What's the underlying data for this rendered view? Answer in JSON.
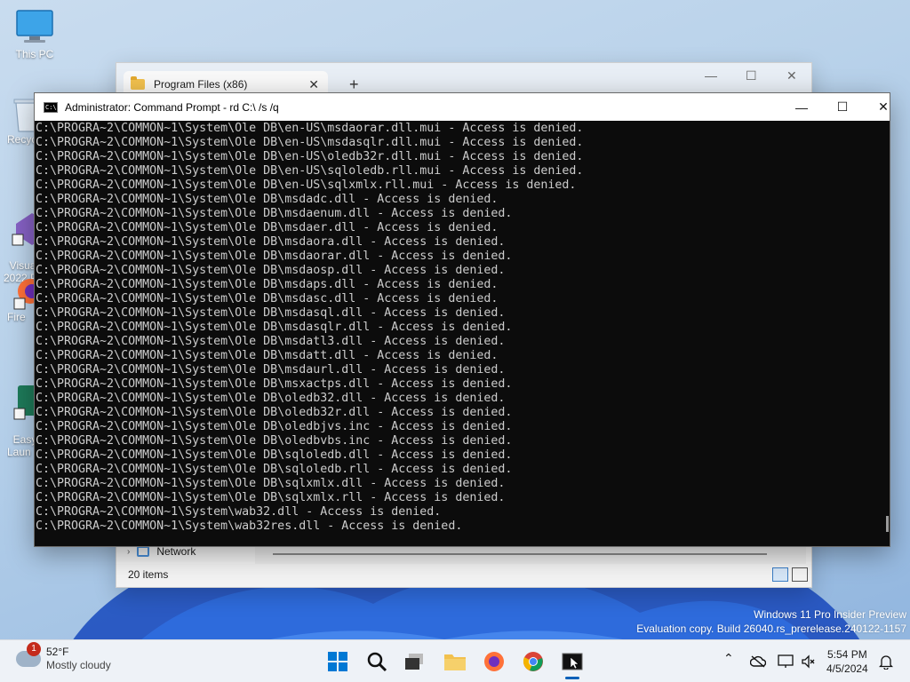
{
  "desktop": {
    "icons": [
      {
        "label": "This PC"
      },
      {
        "label": "Recyc"
      },
      {
        "label": "Visual\n2022 P"
      },
      {
        "label": "Fire"
      },
      {
        "label": "Easy\nLaun"
      }
    ]
  },
  "explorer": {
    "tab_title": "Program Files (x86)",
    "tab_close": "✕",
    "new_tab": "+",
    "nav_item": "Network",
    "status_items": "20 items"
  },
  "console": {
    "title": "Administrator: Command Prompt - rd  C:\\ /s /q",
    "minimize": "—",
    "maximize": "☐",
    "close": "✕",
    "lines": [
      "C:\\PROGRA~2\\COMMON~1\\System\\Ole DB\\en-US\\msdaorar.dll.mui - Access is denied.",
      "C:\\PROGRA~2\\COMMON~1\\System\\Ole DB\\en-US\\msdasqlr.dll.mui - Access is denied.",
      "C:\\PROGRA~2\\COMMON~1\\System\\Ole DB\\en-US\\oledb32r.dll.mui - Access is denied.",
      "C:\\PROGRA~2\\COMMON~1\\System\\Ole DB\\en-US\\sqloledb.rll.mui - Access is denied.",
      "C:\\PROGRA~2\\COMMON~1\\System\\Ole DB\\en-US\\sqlxmlx.rll.mui - Access is denied.",
      "C:\\PROGRA~2\\COMMON~1\\System\\Ole DB\\msdadc.dll - Access is denied.",
      "C:\\PROGRA~2\\COMMON~1\\System\\Ole DB\\msdaenum.dll - Access is denied.",
      "C:\\PROGRA~2\\COMMON~1\\System\\Ole DB\\msdaer.dll - Access is denied.",
      "C:\\PROGRA~2\\COMMON~1\\System\\Ole DB\\msdaora.dll - Access is denied.",
      "C:\\PROGRA~2\\COMMON~1\\System\\Ole DB\\msdaorar.dll - Access is denied.",
      "C:\\PROGRA~2\\COMMON~1\\System\\Ole DB\\msdaosp.dll - Access is denied.",
      "C:\\PROGRA~2\\COMMON~1\\System\\Ole DB\\msdaps.dll - Access is denied.",
      "C:\\PROGRA~2\\COMMON~1\\System\\Ole DB\\msdasc.dll - Access is denied.",
      "C:\\PROGRA~2\\COMMON~1\\System\\Ole DB\\msdasql.dll - Access is denied.",
      "C:\\PROGRA~2\\COMMON~1\\System\\Ole DB\\msdasqlr.dll - Access is denied.",
      "C:\\PROGRA~2\\COMMON~1\\System\\Ole DB\\msdatl3.dll - Access is denied.",
      "C:\\PROGRA~2\\COMMON~1\\System\\Ole DB\\msdatt.dll - Access is denied.",
      "C:\\PROGRA~2\\COMMON~1\\System\\Ole DB\\msdaurl.dll - Access is denied.",
      "C:\\PROGRA~2\\COMMON~1\\System\\Ole DB\\msxactps.dll - Access is denied.",
      "C:\\PROGRA~2\\COMMON~1\\System\\Ole DB\\oledb32.dll - Access is denied.",
      "C:\\PROGRA~2\\COMMON~1\\System\\Ole DB\\oledb32r.dll - Access is denied.",
      "C:\\PROGRA~2\\COMMON~1\\System\\Ole DB\\oledbjvs.inc - Access is denied.",
      "C:\\PROGRA~2\\COMMON~1\\System\\Ole DB\\oledbvbs.inc - Access is denied.",
      "C:\\PROGRA~2\\COMMON~1\\System\\Ole DB\\sqloledb.dll - Access is denied.",
      "C:\\PROGRA~2\\COMMON~1\\System\\Ole DB\\sqloledb.rll - Access is denied.",
      "C:\\PROGRA~2\\COMMON~1\\System\\Ole DB\\sqlxmlx.dll - Access is denied.",
      "C:\\PROGRA~2\\COMMON~1\\System\\Ole DB\\sqlxmlx.rll - Access is denied.",
      "C:\\PROGRA~2\\COMMON~1\\System\\wab32.dll - Access is denied.",
      "C:\\PROGRA~2\\COMMON~1\\System\\wab32res.dll - Access is denied."
    ]
  },
  "watermark": {
    "line1": "Windows 11 Pro Insider Preview",
    "line2": "Evaluation copy. Build 26040.rs_prerelease.240122-1157"
  },
  "taskbar": {
    "weather": {
      "badge": "1",
      "temp": "52°F",
      "condition": "Mostly cloudy"
    },
    "apps": [
      {
        "name": "start-button",
        "icon": "windows-logo-icon"
      },
      {
        "name": "search-button",
        "icon": "search-icon"
      },
      {
        "name": "task-view-button",
        "icon": "task-view-icon"
      },
      {
        "name": "file-explorer-app",
        "icon": "folder-icon"
      },
      {
        "name": "firefox-app",
        "icon": "firefox-icon"
      },
      {
        "name": "chrome-app",
        "icon": "chrome-icon"
      },
      {
        "name": "terminal-app",
        "icon": "terminal-icon"
      }
    ],
    "clock": {
      "time": "5:54 PM",
      "date": "4/5/2024"
    }
  },
  "colors": {
    "accent": "#005fb8",
    "console_bg": "#0c0c0c",
    "console_fg": "#cccccc",
    "badge": "#c42b1c"
  }
}
